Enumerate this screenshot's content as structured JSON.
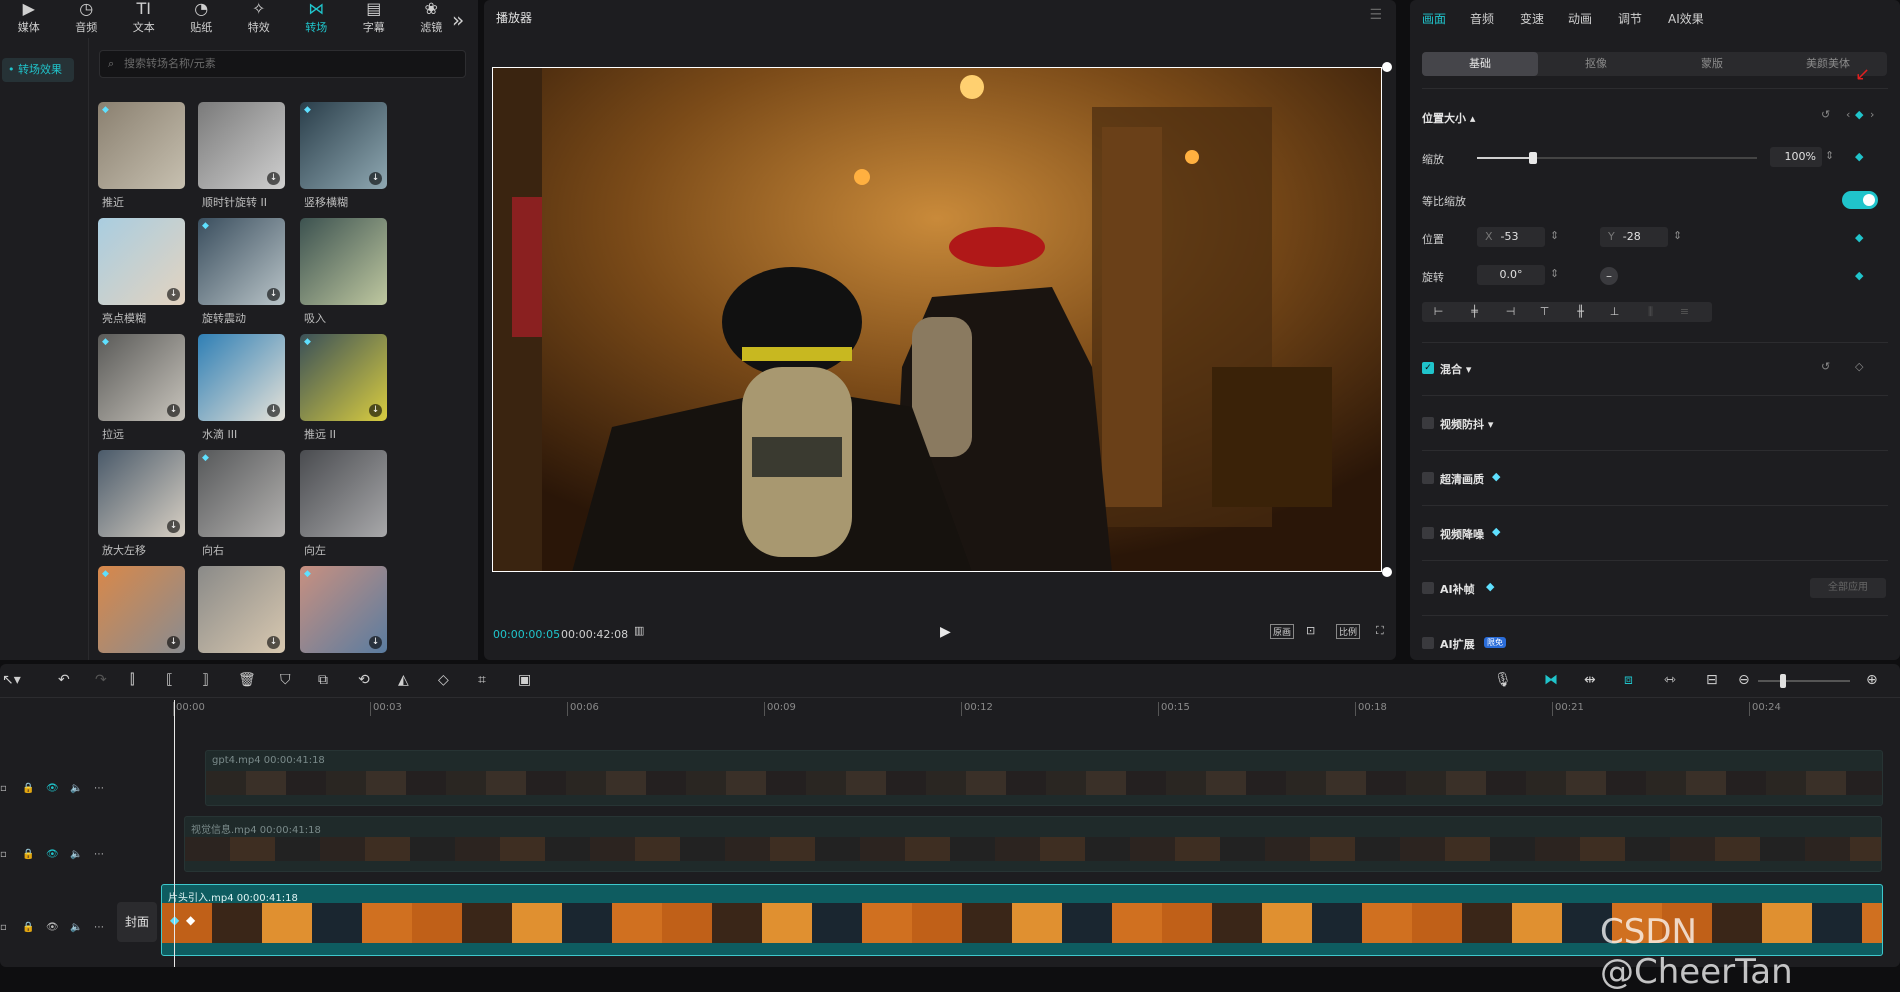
{
  "toolbar": {
    "items": [
      {
        "label": "媒体",
        "icon": "▶"
      },
      {
        "label": "音频",
        "icon": "◷"
      },
      {
        "label": "文本",
        "icon": "TI"
      },
      {
        "label": "贴纸",
        "icon": "◔"
      },
      {
        "label": "特效",
        "icon": "✧"
      },
      {
        "label": "转场",
        "icon": "⋈"
      },
      {
        "label": "字幕",
        "icon": "▤"
      },
      {
        "label": "滤镜",
        "icon": "❀"
      }
    ],
    "more_icon": "»"
  },
  "sidebar": {
    "category": "• 转场效果"
  },
  "effects": {
    "search_placeholder": "搜索转场名称/元素",
    "items": [
      {
        "label": "推近",
        "colors": [
          "#8a8070",
          "#c7c0b0"
        ]
      },
      {
        "label": "顺时针旋转 II",
        "colors": [
          "#7a7a7a",
          "#cfcfcf"
        ]
      },
      {
        "label": "竖移横糊",
        "colors": [
          "#2a3e4a",
          "#8fa8b2"
        ]
      },
      {
        "label": "亮点模糊",
        "colors": [
          "#a9cde0",
          "#e3d3c0"
        ]
      },
      {
        "label": "旋转震动",
        "colors": [
          "#3a4e5e",
          "#b9c4c8"
        ]
      },
      {
        "label": "吸入",
        "colors": [
          "#3c5250",
          "#bfc8a0"
        ]
      },
      {
        "label": "拉远",
        "colors": [
          "#5a5a58",
          "#c8c4bc"
        ]
      },
      {
        "label": "水滴 III",
        "colors": [
          "#2f7fb5",
          "#e6e2d8"
        ]
      },
      {
        "label": "推远 II",
        "colors": [
          "#3a5058",
          "#d8cc40"
        ]
      },
      {
        "label": "放大左移",
        "colors": [
          "#4a5a6a",
          "#d8d0c4"
        ]
      },
      {
        "label": "向右",
        "colors": [
          "#56585a",
          "#b4b2b0"
        ]
      },
      {
        "label": "向左",
        "colors": [
          "#4a4c50",
          "#a8a8aa"
        ]
      },
      {
        "label": "",
        "colors": [
          "#d8884a",
          "#8a8c90"
        ]
      },
      {
        "label": "",
        "colors": [
          "#8a8a88",
          "#d8c8b0"
        ]
      },
      {
        "label": "",
        "colors": [
          "#c89080",
          "#5a7ca0"
        ]
      }
    ]
  },
  "player": {
    "title": "播放器",
    "current_time": "00:00:00:05",
    "total_time": "00:00:42:08",
    "buttons": [
      "原画",
      "⊡",
      "比例",
      "⛶"
    ]
  },
  "right": {
    "tabs": [
      "画面",
      "音频",
      "变速",
      "动画",
      "调节",
      "AI效果"
    ],
    "subtabs": [
      "基础",
      "抠像",
      "蒙版",
      "美颜美体"
    ],
    "section_position": "位置大小 ▴",
    "scale_label": "缩放",
    "scale_value": "100%",
    "scale_level": 0.2,
    "uniform_label": "等比缩放",
    "position_label": "位置",
    "pos_x_label": "X",
    "pos_x": "-53",
    "pos_y_label": "Y",
    "pos_y": "-28",
    "rotate_label": "旋转",
    "rotate_value": "0.0°",
    "mix_label": "混合 ▾",
    "stabilize_label": "视频防抖 ▾",
    "hd_label": "超清画质",
    "denoise_label": "视频降噪",
    "ai_frame_label": "AI补帧",
    "ai_frame_button": "全部应用",
    "ai_expand_label": "AI扩展",
    "ai_expand_badge": "限免"
  },
  "timeline": {
    "ticks": [
      "00:00",
      "00:03",
      "00:06",
      "00:09",
      "00:12",
      "00:15",
      "00:18",
      "00:21",
      "00:24"
    ],
    "tracks": [
      {
        "name": "gpt4.mp4  00:00:41:18"
      },
      {
        "name": "视觉信息.mp4  00:00:41:18"
      },
      {
        "name": "片头引入.mp4  00:00:41:18"
      }
    ],
    "cover_label": "封面"
  },
  "watermark": "CSDN @CheerTan"
}
